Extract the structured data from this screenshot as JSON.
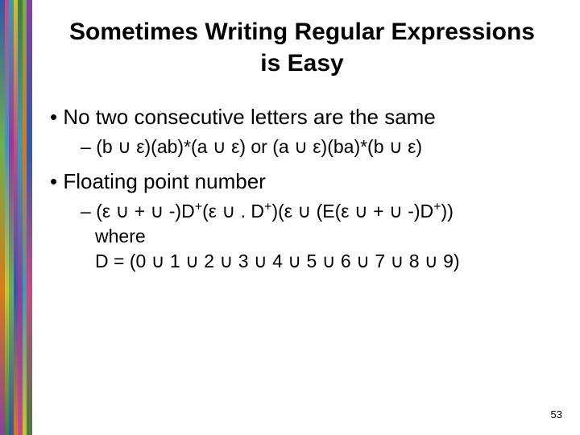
{
  "title_line1": "Sometimes Writing Regular Expressions",
  "title_line2": "is Easy",
  "bullets": {
    "b1": {
      "label": "No two consecutive letters are the same",
      "sub1": "(b ∪ ε)(ab)*(a ∪ ε) or (a ∪ ε)(ba)*(b ∪ ε)"
    },
    "b2": {
      "label": "Floating point number",
      "sub1_pre": "(ε ∪ + ∪ -)D",
      "sub1_mid1": "(ε ∪ . D",
      "sub1_mid2": ")(ε ∪ (E(ε ∪ + ∪ -)D",
      "sub1_post": "))",
      "sub1_line2": "where",
      "sub1_line3": "D = (0 ∪ 1 ∪ 2 ∪ 3 ∪ 4 ∪ 5 ∪ 6 ∪ 7 ∪ 8 ∪ 9)"
    }
  },
  "page_number": "53",
  "strip_colors": [
    "#2e5aa8",
    "#6fb04a",
    "#d97a1a",
    "#8a3fa0",
    "#c74a86",
    "#3a9bb7",
    "#d0c030",
    "#4a7a3a"
  ]
}
